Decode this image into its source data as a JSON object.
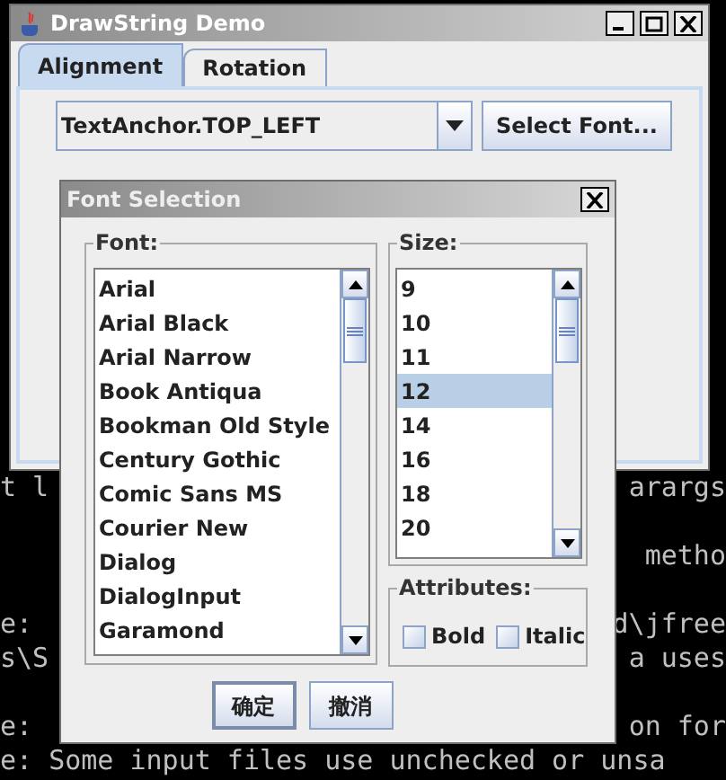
{
  "terminal": {
    "lines": [
      {
        "kind": "text",
        "left": "t l",
        "right": "arargs"
      },
      {
        "kind": "blank"
      },
      {
        "kind": "text",
        "right": "metho"
      },
      {
        "kind": "blank"
      },
      {
        "kind": "text",
        "left": "e:",
        "right": "d\\jfree"
      },
      {
        "kind": "text",
        "left": "s\\S",
        "right": "a uses"
      },
      {
        "kind": "blank"
      },
      {
        "kind": "text",
        "left": "e:",
        "right": "on for"
      },
      {
        "kind": "text",
        "left": "e: Some input files use unchecked or unsa"
      }
    ]
  },
  "main_window": {
    "title": "DrawString Demo",
    "tabs": [
      {
        "label": "Alignment",
        "selected": true
      },
      {
        "label": "Rotation",
        "selected": false
      }
    ],
    "anchor_combo": {
      "value": "TextAnchor.TOP_LEFT"
    },
    "select_font_button": "Select Font..."
  },
  "dialog": {
    "title": "Font Selection",
    "font": {
      "label": "Font:",
      "items": [
        {
          "name": "Arial",
          "selected": false
        },
        {
          "name": "Arial Black",
          "selected": false
        },
        {
          "name": "Arial Narrow",
          "selected": false
        },
        {
          "name": "Book Antiqua",
          "selected": false
        },
        {
          "name": "Bookman Old Style",
          "selected": false
        },
        {
          "name": "Century Gothic",
          "selected": false
        },
        {
          "name": "Comic Sans MS",
          "selected": false
        },
        {
          "name": "Courier New",
          "selected": false
        },
        {
          "name": "Dialog",
          "selected": false
        },
        {
          "name": "DialogInput",
          "selected": false
        },
        {
          "name": "Garamond",
          "selected": false
        }
      ]
    },
    "size": {
      "label": "Size:",
      "items": [
        {
          "name": "9",
          "selected": false
        },
        {
          "name": "10",
          "selected": false
        },
        {
          "name": "11",
          "selected": false
        },
        {
          "name": "12",
          "selected": true
        },
        {
          "name": "14",
          "selected": false
        },
        {
          "name": "16",
          "selected": false
        },
        {
          "name": "18",
          "selected": false
        },
        {
          "name": "20",
          "selected": false
        }
      ]
    },
    "attributes": {
      "label": "Attributes:",
      "options": [
        {
          "label": "Bold",
          "checked": false
        },
        {
          "label": "Italic",
          "checked": false
        }
      ]
    },
    "buttons": [
      "确定",
      "撤消"
    ]
  }
}
